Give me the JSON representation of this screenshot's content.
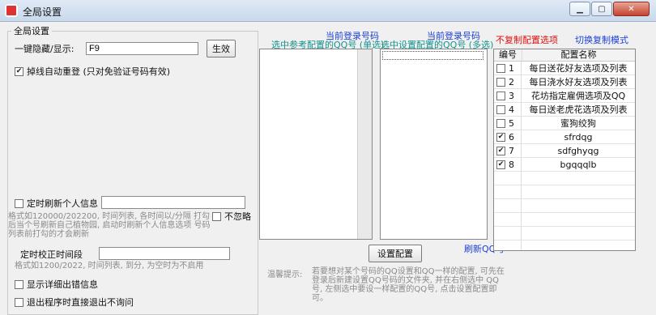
{
  "window": {
    "title": "全局设置"
  },
  "global_group": {
    "legend": "全局设置",
    "hotkey_label": "一键隐藏/显示:",
    "hotkey_value": "F9",
    "apply_button": "生效",
    "reconnect_checkbox_label": "掉线自动重登 (只对免验证号码有效)",
    "reconnect_checked": true,
    "refresh_checkbox_label": "定时刷新个人信息",
    "refresh_checked": false,
    "refresh_hint": "格式如120000/202200, 时间列表, 各时间以/分隔 打勾后当个号刷新自己植物园, 启动时刷新个人信息选项 号码列表前打勾的才会刷新",
    "ignore_label": "不忽略",
    "ignore_checked": false,
    "calibrate_label": "定时校正时间段",
    "calibrate_hint": "格式如1200/2022, 时间列表, 到分, 为空时为不启用",
    "show_detail_label": "显示详细出错信息",
    "show_detail_checked": false,
    "exit_direct_label": "退出程序时直接退出不询问",
    "exit_direct_checked": false
  },
  "middle": {
    "left_list_title_top": "当前登录号码",
    "left_list_title_bottom": "选中参考配置的QQ号 (单选)",
    "right_list_title_top": "当前登录号码",
    "right_list_title_bottom": "选中设置配置的QQ号 (多选)",
    "set_config_button": "设置配置",
    "refresh_qq_link": "刷新QQ号",
    "tip_label": "温馨提示:",
    "tip_text": "若要想对某个号码的QQ设置和QQ一样的配置, 可先在登录后新建设置QQ号码的文件夹, 并在右侧选中 QQ号, 左侧选中要设一样配置的QQ号, 点击设置配置即可。"
  },
  "right": {
    "no_copy_label": "不复制配置选项",
    "switch_mode_link": "切换复制模式",
    "table_headers": [
      "编号",
      "配置名称"
    ],
    "rows": [
      {
        "id": "1",
        "name": "每日送花好友选项及列表",
        "checked": false
      },
      {
        "id": "2",
        "name": "每日浇水好友选项及列表",
        "checked": false
      },
      {
        "id": "3",
        "name": "花坊指定雇佣选项及QQ",
        "checked": false
      },
      {
        "id": "4",
        "name": "每日送老虎花选项及列表",
        "checked": false
      },
      {
        "id": "5",
        "name": "蜜狗绞狗",
        "checked": false
      },
      {
        "id": "6",
        "name": "sfrdqg",
        "checked": true
      },
      {
        "id": "7",
        "name": "sdfghyqg",
        "checked": true
      },
      {
        "id": "8",
        "name": "bgqqqlb",
        "checked": true
      }
    ]
  }
}
